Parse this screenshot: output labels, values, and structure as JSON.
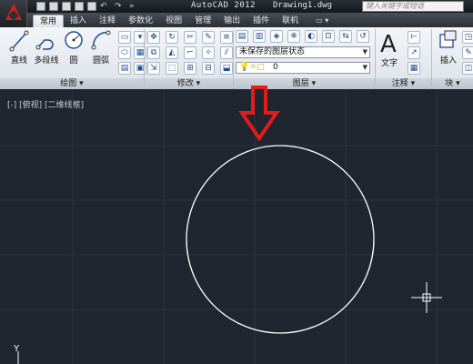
{
  "app": {
    "title": "AutoCAD 2012",
    "filename": "Drawing1.dwg",
    "search_placeholder": "键入关键字或短语"
  },
  "tabs": [
    {
      "label": "常用"
    },
    {
      "label": "插入"
    },
    {
      "label": "注释"
    },
    {
      "label": "参数化"
    },
    {
      "label": "视图"
    },
    {
      "label": "管理"
    },
    {
      "label": "输出"
    },
    {
      "label": "插件"
    },
    {
      "label": "联机"
    }
  ],
  "ribbon": {
    "draw_tools": {
      "line": "直线",
      "polyline": "多段线",
      "circle": "圆",
      "arc": "圆弧"
    },
    "panels": {
      "draw": "绘图 ▾",
      "modify": "修改 ▾",
      "layers": "图层 ▾",
      "annotation": "注释 ▾",
      "block": "块 ▾"
    },
    "layer_state": "未保存的图层状态",
    "current_layer": "0",
    "text_tool": "文字",
    "insert_tool": "插入"
  },
  "viewport": {
    "label": "[-] [俯视] [二维线框]",
    "ucs_y": "Y"
  },
  "colors": {
    "canvas": "#1f2630",
    "arrow": "#e21b1b",
    "circle": "#ffffff",
    "grid": "#2c3440"
  }
}
